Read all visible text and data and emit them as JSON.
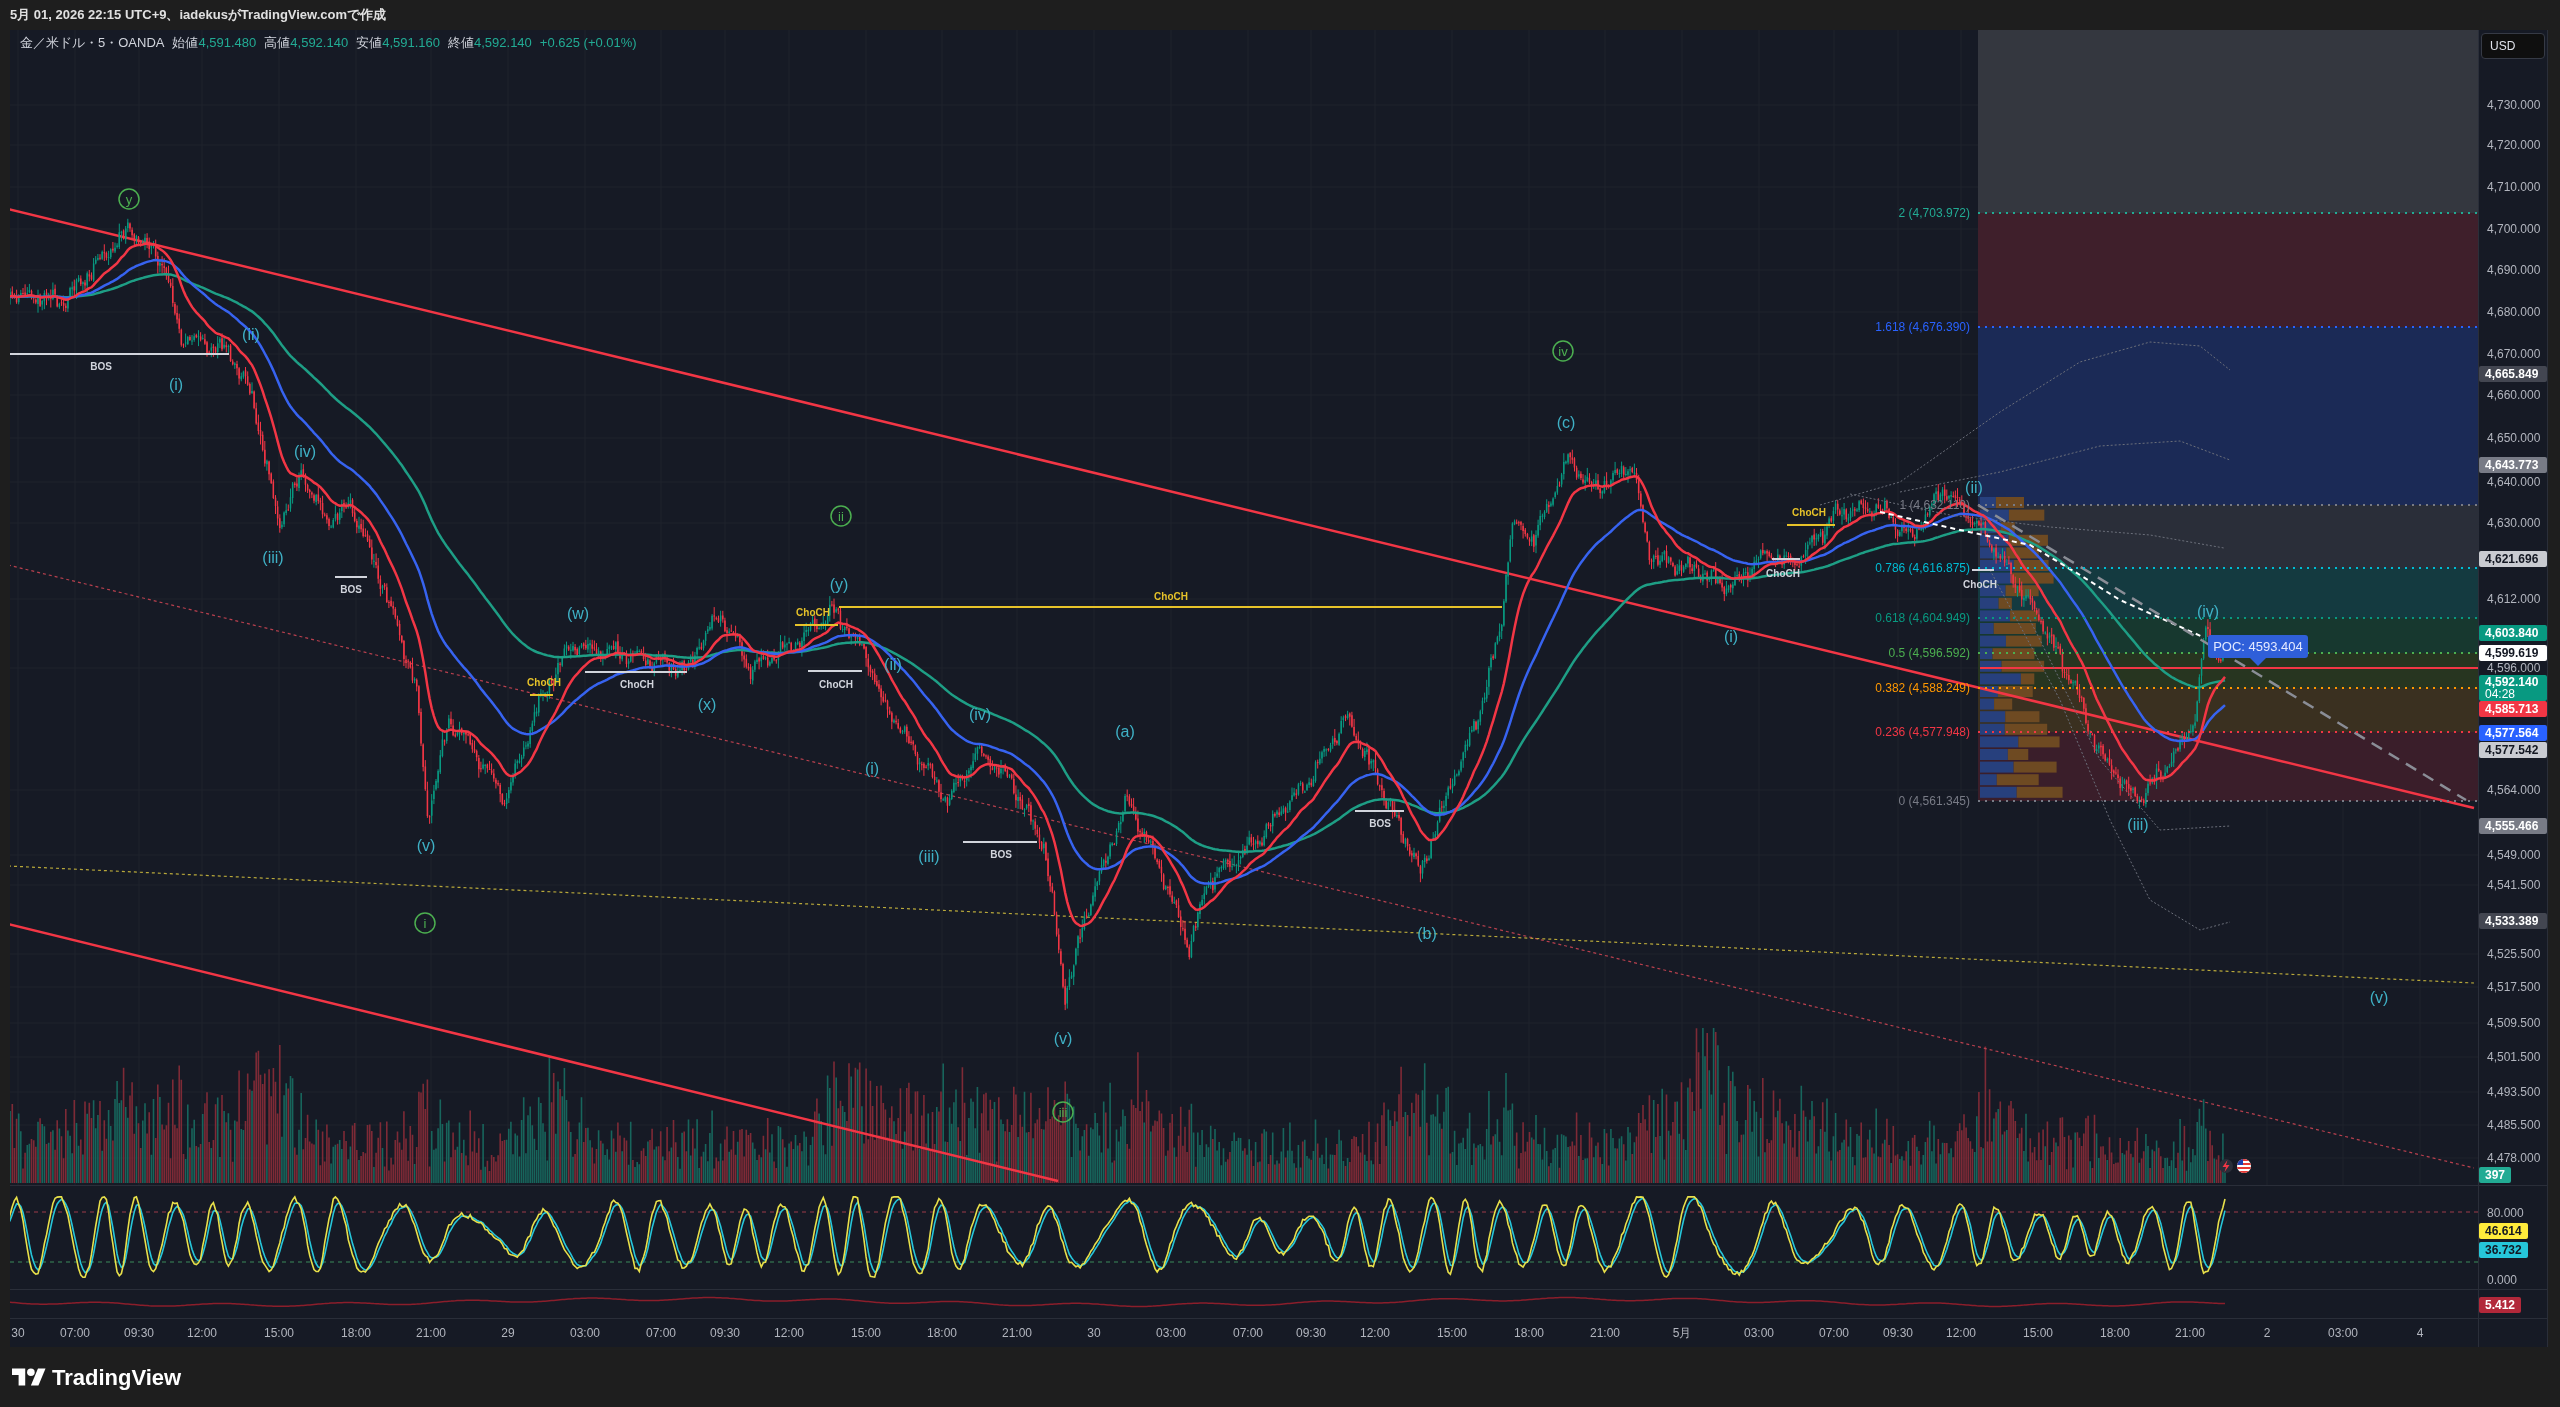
{
  "caption": "5月 01, 2026 22:15 UTC+9、iadekusがTradingView.comで作成",
  "legend": {
    "symbol": "金／米ドル・5・OANDA",
    "fields": [
      {
        "label": "始値",
        "value": "4,591.480"
      },
      {
        "label": "高値",
        "value": "4,592.140"
      },
      {
        "label": "安値",
        "value": "4,591.160"
      },
      {
        "label": "終値",
        "value": "4,592.140"
      }
    ],
    "change": "+0.625 (+0.01%)"
  },
  "chart": {
    "wave_labels": [
      {
        "text": "y",
        "kind": "circled"
      },
      {
        "text": "(i)",
        "kind": "plain"
      },
      {
        "text": "(ii)",
        "kind": "plain"
      },
      {
        "text": "(iii)",
        "kind": "plain"
      },
      {
        "text": "(iv)",
        "kind": "plain"
      },
      {
        "text": "i",
        "kind": "circled"
      },
      {
        "text": "(v)",
        "kind": "plain"
      },
      {
        "text": "(w)",
        "kind": "plain"
      },
      {
        "text": "(x)",
        "kind": "plain"
      },
      {
        "text": "(y)",
        "kind": "plain"
      },
      {
        "text": "ii",
        "kind": "circled"
      },
      {
        "text": "(i)",
        "kind": "plain"
      },
      {
        "text": "(ii)",
        "kind": "plain"
      },
      {
        "text": "(iii)",
        "kind": "plain"
      },
      {
        "text": "(iv)",
        "kind": "plain"
      },
      {
        "text": "(v)",
        "kind": "plain"
      },
      {
        "text": "iii",
        "kind": "circled"
      },
      {
        "text": "(a)",
        "kind": "plain"
      },
      {
        "text": "(b)",
        "kind": "plain"
      },
      {
        "text": "iv",
        "kind": "circled"
      },
      {
        "text": "(c)",
        "kind": "plain"
      },
      {
        "text": "(i)",
        "kind": "plain"
      },
      {
        "text": "(ii)",
        "kind": "plain"
      },
      {
        "text": "(iii)",
        "kind": "plain"
      },
      {
        "text": "(iv)",
        "kind": "plain"
      },
      {
        "text": "(v)",
        "kind": "plain"
      }
    ],
    "structure_labels": [
      {
        "text": "BOS",
        "color": "#d1d4dc"
      },
      {
        "text": "BOS",
        "color": "#d1d4dc"
      },
      {
        "text": "ChoCH",
        "color": "#e6c229"
      },
      {
        "text": "ChoCH",
        "color": "#d1d4dc"
      },
      {
        "text": "ChoCH",
        "color": "#e6c229"
      },
      {
        "text": "ChoCH",
        "color": "#d1d4dc"
      },
      {
        "text": "BOS",
        "color": "#d1d4dc"
      },
      {
        "text": "ChoCH",
        "color": "#e6c229"
      },
      {
        "text": "BOS",
        "color": "#d1d4dc"
      },
      {
        "text": "ChoCH",
        "color": "#d1d4dc"
      },
      {
        "text": "ChoCH",
        "color": "#e6c229"
      },
      {
        "text": "ChoCH",
        "color": "#d1d4dc"
      }
    ],
    "fib_levels": [
      {
        "label": "2 (4,703.972)",
        "color": "#22ab94"
      },
      {
        "label": "1.618 (4,676.390)",
        "color": "#2962ff"
      },
      {
        "label": "1 (4,632.110)",
        "color": "#787b86"
      },
      {
        "label": "0.786 (4,616.875)",
        "color": "#00bcd4"
      },
      {
        "label": "0.618 (4,604.949)",
        "color": "#089981"
      },
      {
        "label": "0.5 (4,596.592)",
        "color": "#4caf50"
      },
      {
        "label": "0.382 (4,588.249)",
        "color": "#ff9800"
      },
      {
        "label": "0.236 (4,577.948)",
        "color": "#f23645"
      },
      {
        "label": "0 (4,561.345)",
        "color": "#787b86"
      }
    ],
    "poc": "POC: 4593.404"
  },
  "price_axis": {
    "currency": "USD",
    "ticks": [
      "4,730.000",
      "4,720.000",
      "4,710.000",
      "4,700.000",
      "4,690.000",
      "4,680.000",
      "4,670.000",
      "4,660.000",
      "4,650.000",
      "4,640.000",
      "4,630.000",
      "4,612.000",
      "4,596.000",
      "4,564.000",
      "4,549.000",
      "4,541.500",
      "4,525.500",
      "4,517.500",
      "4,509.500",
      "4,501.500",
      "4,493.500",
      "4,485.500",
      "4,478.000"
    ],
    "badges": [
      {
        "text": "4,665.849",
        "color": "#434651"
      },
      {
        "text": "4,643.773",
        "color": "#787b86"
      },
      {
        "text": "4,621.696",
        "color": "#c9cbd1"
      },
      {
        "text": "4,603.840",
        "color": "#089981"
      },
      {
        "text": "4,599.619",
        "color": "#ffffff"
      },
      {
        "text": "4,592.140",
        "subtext": "04:28",
        "color": "#089981"
      },
      {
        "text": "4,585.713",
        "color": "#f23645"
      },
      {
        "text": "4,577.564",
        "color": "#2962ff"
      },
      {
        "text": "4,577.542",
        "color": "#c9cbd1"
      },
      {
        "text": "4,555.466",
        "color": "#787b86"
      },
      {
        "text": "4,533.389",
        "color": "#434651"
      }
    ],
    "volume_badge": {
      "text": "397",
      "color": "#22ab94"
    }
  },
  "oscillator_axis": {
    "ticks": [
      "80.000",
      "0.000"
    ],
    "badges": [
      {
        "text": "46.614",
        "color": "#ffeb3b"
      },
      {
        "text": "36.732",
        "color": "#26c6da"
      }
    ]
  },
  "indicator_axis": {
    "badges": [
      {
        "text": "5.412",
        "color": "#b2283a"
      }
    ]
  },
  "time_axis": [
    "30",
    "07:00",
    "09:30",
    "12:00",
    "15:00",
    "18:00",
    "21:00",
    "29",
    "03:00",
    "07:00",
    "09:30",
    "12:00",
    "15:00",
    "18:00",
    "21:00",
    "30",
    "03:00",
    "07:00",
    "09:30",
    "12:00",
    "15:00",
    "18:00",
    "21:00",
    "5月",
    "03:00",
    "07:00",
    "09:30",
    "12:00",
    "15:00",
    "18:00",
    "21:00",
    "2",
    "03:00",
    "4"
  ],
  "footer": {
    "brand": "TradingView"
  }
}
